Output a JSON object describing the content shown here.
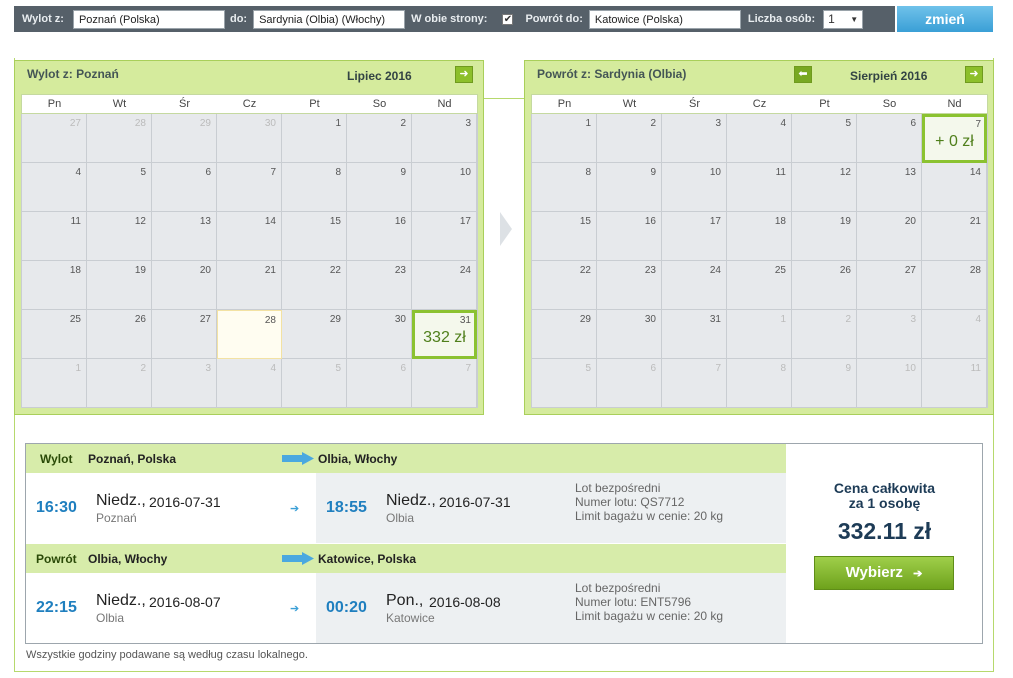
{
  "search": {
    "from_label": "Wylot z:",
    "from_value": "Poznań (Polska)",
    "to_label": "do:",
    "to_value": "Sardynia (Olbia) (Włochy)",
    "both_ways_label": "W obie strony:",
    "both_ways_checked": "✔",
    "return_from_label": "Powrót do:",
    "return_value": "Katowice (Polska)",
    "persons_label": "Liczba osób:",
    "persons_value": "1",
    "submit_label": "zmień"
  },
  "outbound_calendar": {
    "title": "Wylot z: Poznań",
    "month": "Lipiec 2016",
    "weekdays": [
      "Pn",
      "Wt",
      "Śr",
      "Cz",
      "Pt",
      "So",
      "Nd"
    ],
    "days": [
      {
        "n": "27",
        "other": true
      },
      {
        "n": "28",
        "other": true
      },
      {
        "n": "29",
        "other": true
      },
      {
        "n": "30",
        "other": true
      },
      {
        "n": "1"
      },
      {
        "n": "2"
      },
      {
        "n": "3"
      },
      {
        "n": "4"
      },
      {
        "n": "5"
      },
      {
        "n": "6"
      },
      {
        "n": "7"
      },
      {
        "n": "8"
      },
      {
        "n": "9"
      },
      {
        "n": "10"
      },
      {
        "n": "11"
      },
      {
        "n": "12"
      },
      {
        "n": "13"
      },
      {
        "n": "14"
      },
      {
        "n": "15"
      },
      {
        "n": "16"
      },
      {
        "n": "17"
      },
      {
        "n": "18"
      },
      {
        "n": "19"
      },
      {
        "n": "20"
      },
      {
        "n": "21"
      },
      {
        "n": "22"
      },
      {
        "n": "23"
      },
      {
        "n": "24"
      },
      {
        "n": "25"
      },
      {
        "n": "26"
      },
      {
        "n": "27"
      },
      {
        "n": "28",
        "hover": true
      },
      {
        "n": "29"
      },
      {
        "n": "30"
      },
      {
        "n": "31",
        "selected": true,
        "price": "332 zł"
      },
      {
        "n": "1",
        "other": true
      },
      {
        "n": "2",
        "other": true
      },
      {
        "n": "3",
        "other": true
      },
      {
        "n": "4",
        "other": true
      },
      {
        "n": "5",
        "other": true
      },
      {
        "n": "6",
        "other": true
      },
      {
        "n": "7",
        "other": true
      }
    ]
  },
  "return_calendar": {
    "title": "Powrót z: Sardynia (Olbia)",
    "month": "Sierpień 2016",
    "weekdays": [
      "Pn",
      "Wt",
      "Śr",
      "Cz",
      "Pt",
      "So",
      "Nd"
    ],
    "days": [
      {
        "n": "1"
      },
      {
        "n": "2"
      },
      {
        "n": "3"
      },
      {
        "n": "4"
      },
      {
        "n": "5"
      },
      {
        "n": "6"
      },
      {
        "n": "7",
        "selected": true,
        "price": "+ 0 zł"
      },
      {
        "n": "8"
      },
      {
        "n": "9"
      },
      {
        "n": "10"
      },
      {
        "n": "11"
      },
      {
        "n": "12"
      },
      {
        "n": "13"
      },
      {
        "n": "14"
      },
      {
        "n": "15"
      },
      {
        "n": "16"
      },
      {
        "n": "17"
      },
      {
        "n": "18"
      },
      {
        "n": "19"
      },
      {
        "n": "20"
      },
      {
        "n": "21"
      },
      {
        "n": "22"
      },
      {
        "n": "23"
      },
      {
        "n": "24"
      },
      {
        "n": "25"
      },
      {
        "n": "26"
      },
      {
        "n": "27"
      },
      {
        "n": "28"
      },
      {
        "n": "29"
      },
      {
        "n": "30"
      },
      {
        "n": "31"
      },
      {
        "n": "1",
        "other": true
      },
      {
        "n": "2",
        "other": true
      },
      {
        "n": "3",
        "other": true
      },
      {
        "n": "4",
        "other": true
      },
      {
        "n": "5",
        "other": true
      },
      {
        "n": "6",
        "other": true
      },
      {
        "n": "7",
        "other": true
      },
      {
        "n": "8",
        "other": true
      },
      {
        "n": "9",
        "other": true
      },
      {
        "n": "10",
        "other": true
      },
      {
        "n": "11",
        "other": true
      }
    ]
  },
  "legs": [
    {
      "label": "Wylot",
      "from": "Poznań, Polska",
      "to": "Olbia, Włochy",
      "dep_time": "16:30",
      "dep_day": "Niedz.,",
      "dep_date": "2016-07-31",
      "dep_city": "Poznań",
      "arr_time": "18:55",
      "arr_day": "Niedz.,",
      "arr_date": "2016-07-31",
      "arr_city": "Olbia",
      "info1": "Lot bezpośredni",
      "info2": "Numer lotu: QS7712",
      "info3": "Limit bagażu w cenie: 20 kg"
    },
    {
      "label": "Powrót",
      "from": "Olbia, Włochy",
      "to": "Katowice, Polska",
      "dep_time": "22:15",
      "dep_day": "Niedz.,",
      "dep_date": "2016-08-07",
      "dep_city": "Olbia",
      "arr_time": "00:20",
      "arr_day": "Pon.,",
      "arr_date": "2016-08-08",
      "arr_city": "Katowice",
      "info1": "Lot bezpośredni",
      "info2": "Numer lotu: ENT5796",
      "info3": "Limit bagażu w cenie: 20 kg"
    }
  ],
  "price": {
    "label_line1": "Cena całkowita",
    "label_line2": "za 1 osobę",
    "value": "332.11 zł",
    "button": "Wybierz"
  },
  "footnote": "Wszystkie godziny podawane są według czasu lokalnego."
}
